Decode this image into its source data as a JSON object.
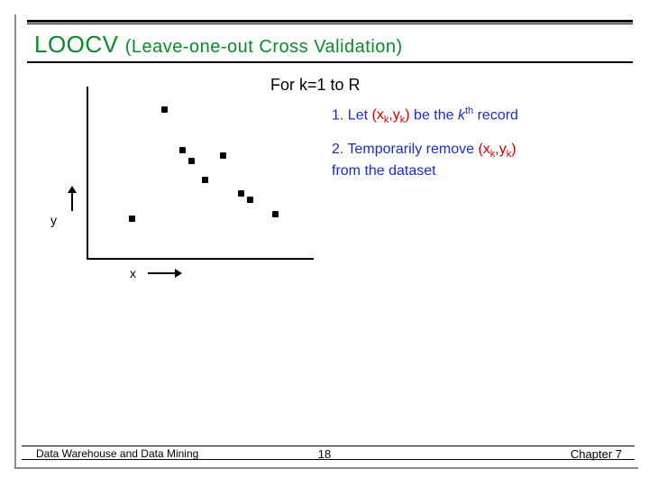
{
  "title": {
    "acronym": "LOOCV",
    "rest": "(Leave-one-out Cross Validation)"
  },
  "for_line": "For k=1 to R",
  "steps": {
    "s1": {
      "num": "1.",
      "lead": "Let ",
      "expr": "(x",
      "k1": "k",
      "mid": ",y",
      "k2": "k",
      "close": ")",
      "tail1": " be the ",
      "kword": "k",
      "th": "th",
      "tail2": " record"
    },
    "s2": {
      "num": "2.",
      "lead": "Temporarily remove ",
      "expr": "(x",
      "k1": "k",
      "mid": ",y",
      "k2": "k",
      "close": ")",
      "tail": "from the dataset"
    }
  },
  "axes": {
    "x": "x",
    "y": "y"
  },
  "footer": {
    "left": "Data Warehouse and Data Mining",
    "center": "18",
    "right": "Chapter 7"
  },
  "chart_data": {
    "type": "scatter",
    "title": "",
    "xlabel": "x",
    "ylabel": "y",
    "xlim": [
      0,
      10
    ],
    "ylim": [
      0,
      10
    ],
    "series": [
      {
        "name": "points",
        "x": [
          2.0,
          3.4,
          4.2,
          4.6,
          5.2,
          6.0,
          6.8,
          7.2,
          8.3
        ],
        "y": [
          2.3,
          8.7,
          6.3,
          5.7,
          4.6,
          6.0,
          3.8,
          3.4,
          2.6
        ]
      }
    ]
  }
}
